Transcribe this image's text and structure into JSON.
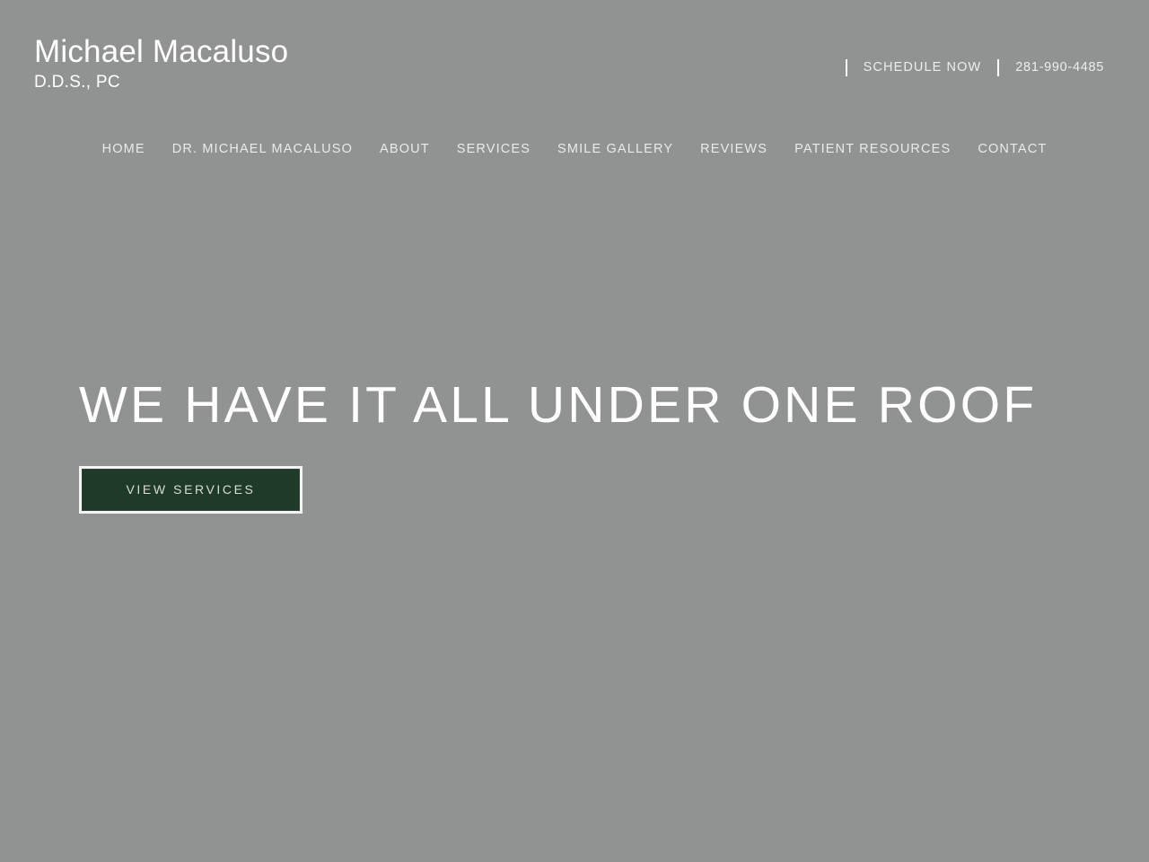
{
  "site": {
    "background_color": "#919392",
    "accent_color": "#1f3a29",
    "text_color": "#ffffff"
  },
  "header": {
    "brand": {
      "name": "Michael Macaluso",
      "subtitle": "D.D.S., PC"
    },
    "utility": {
      "separator": "|",
      "schedule_label": "SCHEDULE NOW",
      "phone": "281-990-4485"
    },
    "nav": [
      {
        "label": "HOME"
      },
      {
        "label": "DR. MICHAEL MACALUSO"
      },
      {
        "label": "ABOUT"
      },
      {
        "label": "SERVICES"
      },
      {
        "label": "SMILE GALLERY"
      },
      {
        "label": "REVIEWS"
      },
      {
        "label": "PATIENT RESOURCES"
      },
      {
        "label": "CONTACT"
      }
    ]
  },
  "hero": {
    "headline": "WE HAVE IT ALL UNDER ONE ROOF",
    "cta_label": "VIEW SERVICES"
  }
}
